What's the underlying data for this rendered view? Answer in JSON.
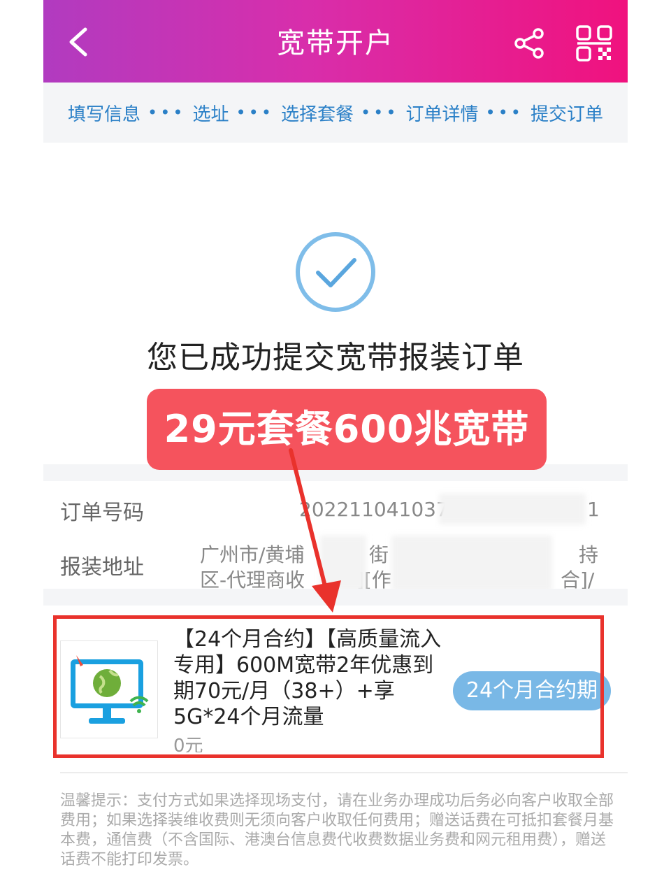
{
  "header": {
    "title": "宽带开户"
  },
  "steps": [
    "填写信息",
    "选址",
    "选择套餐",
    "订单详情",
    "提交订单"
  ],
  "steps_separator": "•••",
  "success_message": "您已成功提交宽带报装订单",
  "promo_banner": "29元套餐600兆宽带",
  "order": {
    "number_label": "订单号码",
    "number_value": "202211041037",
    "number_tail": "1",
    "address_label": "报装地址",
    "address_line1": "广州市/黄埔",
    "address_line2": "区-代理商收",
    "address_frag1": "街",
    "address_frag2": "持",
    "address_frag3": "][作",
    "address_frag4": "合]/"
  },
  "package": {
    "title": "【24个月合约】【高质量流入专用】600M宽带2年优惠到期70元/月（38+）+享5G*24个月流量",
    "price": "0元",
    "badge": "24个月合约期"
  },
  "tip": "温馨提示：支付方式如果选择现场支付，请在业务办理成功后务必向客户收取全部费用；如果选择装维收费则无须向客户收取任何费用；赠送话费在可抵扣套餐月基本费，通信费（不含国际、港澳台信息费代收费数据业务费和网元租用费），赠送话费不能打印发票。",
  "colors": {
    "accent": "#e9322c",
    "step_blue": "#2b80c7",
    "promo_red": "#f5535d"
  }
}
